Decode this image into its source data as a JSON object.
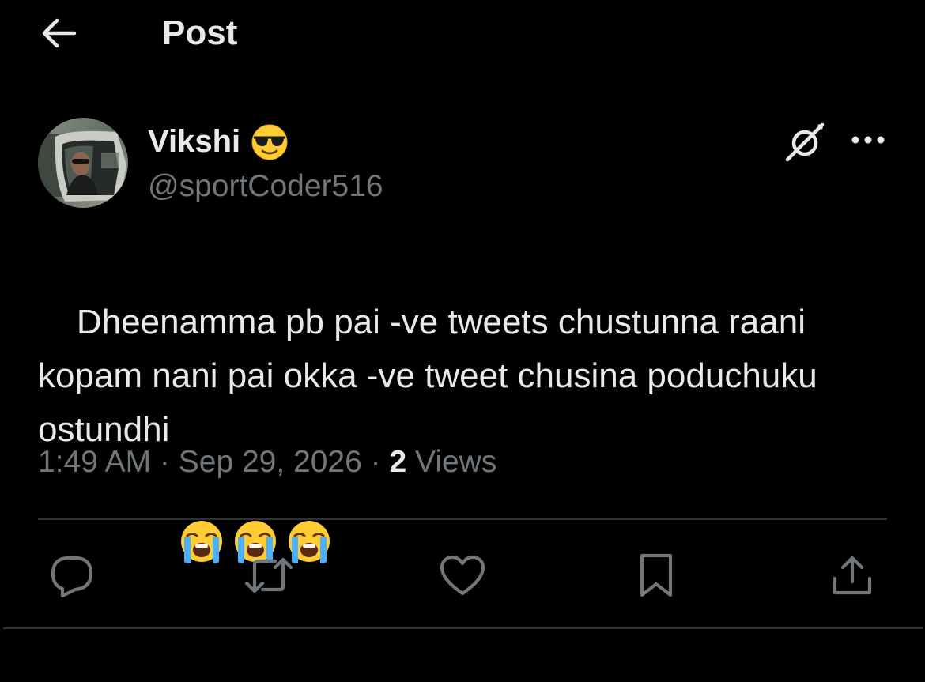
{
  "header": {
    "back_icon": "arrow-left-icon",
    "title": "Post"
  },
  "author": {
    "display_name": "Vikshi",
    "name_emoji": "smiling-face-with-sunglasses",
    "handle": "@sportCoder516",
    "avatar": "avatar-photo"
  },
  "post": {
    "text": "Dheenamma pb pai -ve tweets chustunna raani kopam nani pai okka -ve tweet chusina poduchuku ostundhi",
    "trailing_emojis": [
      "loudly-crying-face",
      "loudly-crying-face",
      "loudly-crying-face"
    ]
  },
  "meta": {
    "time": "1:49 AM",
    "separator": " · ",
    "date": "Sep 29, 2026",
    "views_count": "2",
    "views_label": " Views"
  },
  "actions": {
    "reply": "reply-icon",
    "repost": "repost-icon",
    "like": "heart-icon",
    "bookmark": "bookmark-icon",
    "share": "share-icon"
  },
  "colors": {
    "background": "#000000",
    "text_primary": "#e7e9ea",
    "text_secondary": "#71767b",
    "divider": "#2f3336"
  }
}
